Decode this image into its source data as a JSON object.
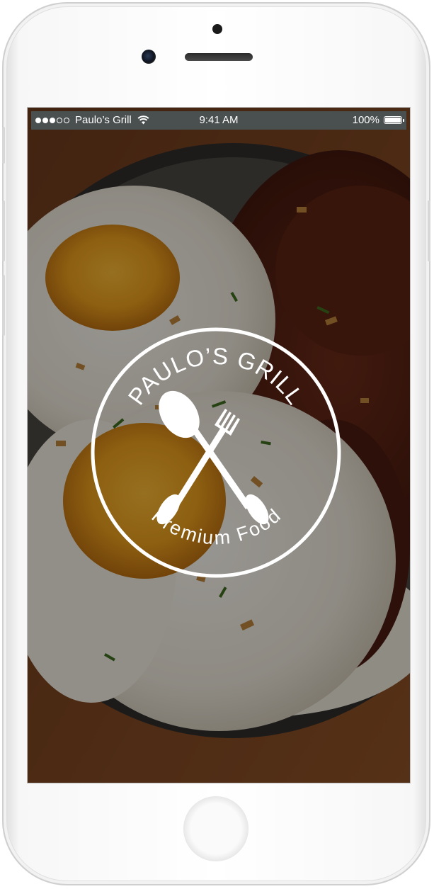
{
  "status_bar": {
    "carrier": "Paulo’s Grill",
    "time": "9:41 AM",
    "battery": "100%",
    "battery_level": 1.0,
    "signal_dots": 3,
    "wifi_icon": "wifi-icon"
  },
  "logo": {
    "title": "PAULO’S GRILL",
    "subtitle": "Premium Food",
    "icons": [
      "spoon-icon",
      "fork-icon"
    ],
    "color": "#ffffff"
  },
  "colors": {
    "status_bar_bg": "#4a4f4f",
    "overlay": "#000000"
  }
}
